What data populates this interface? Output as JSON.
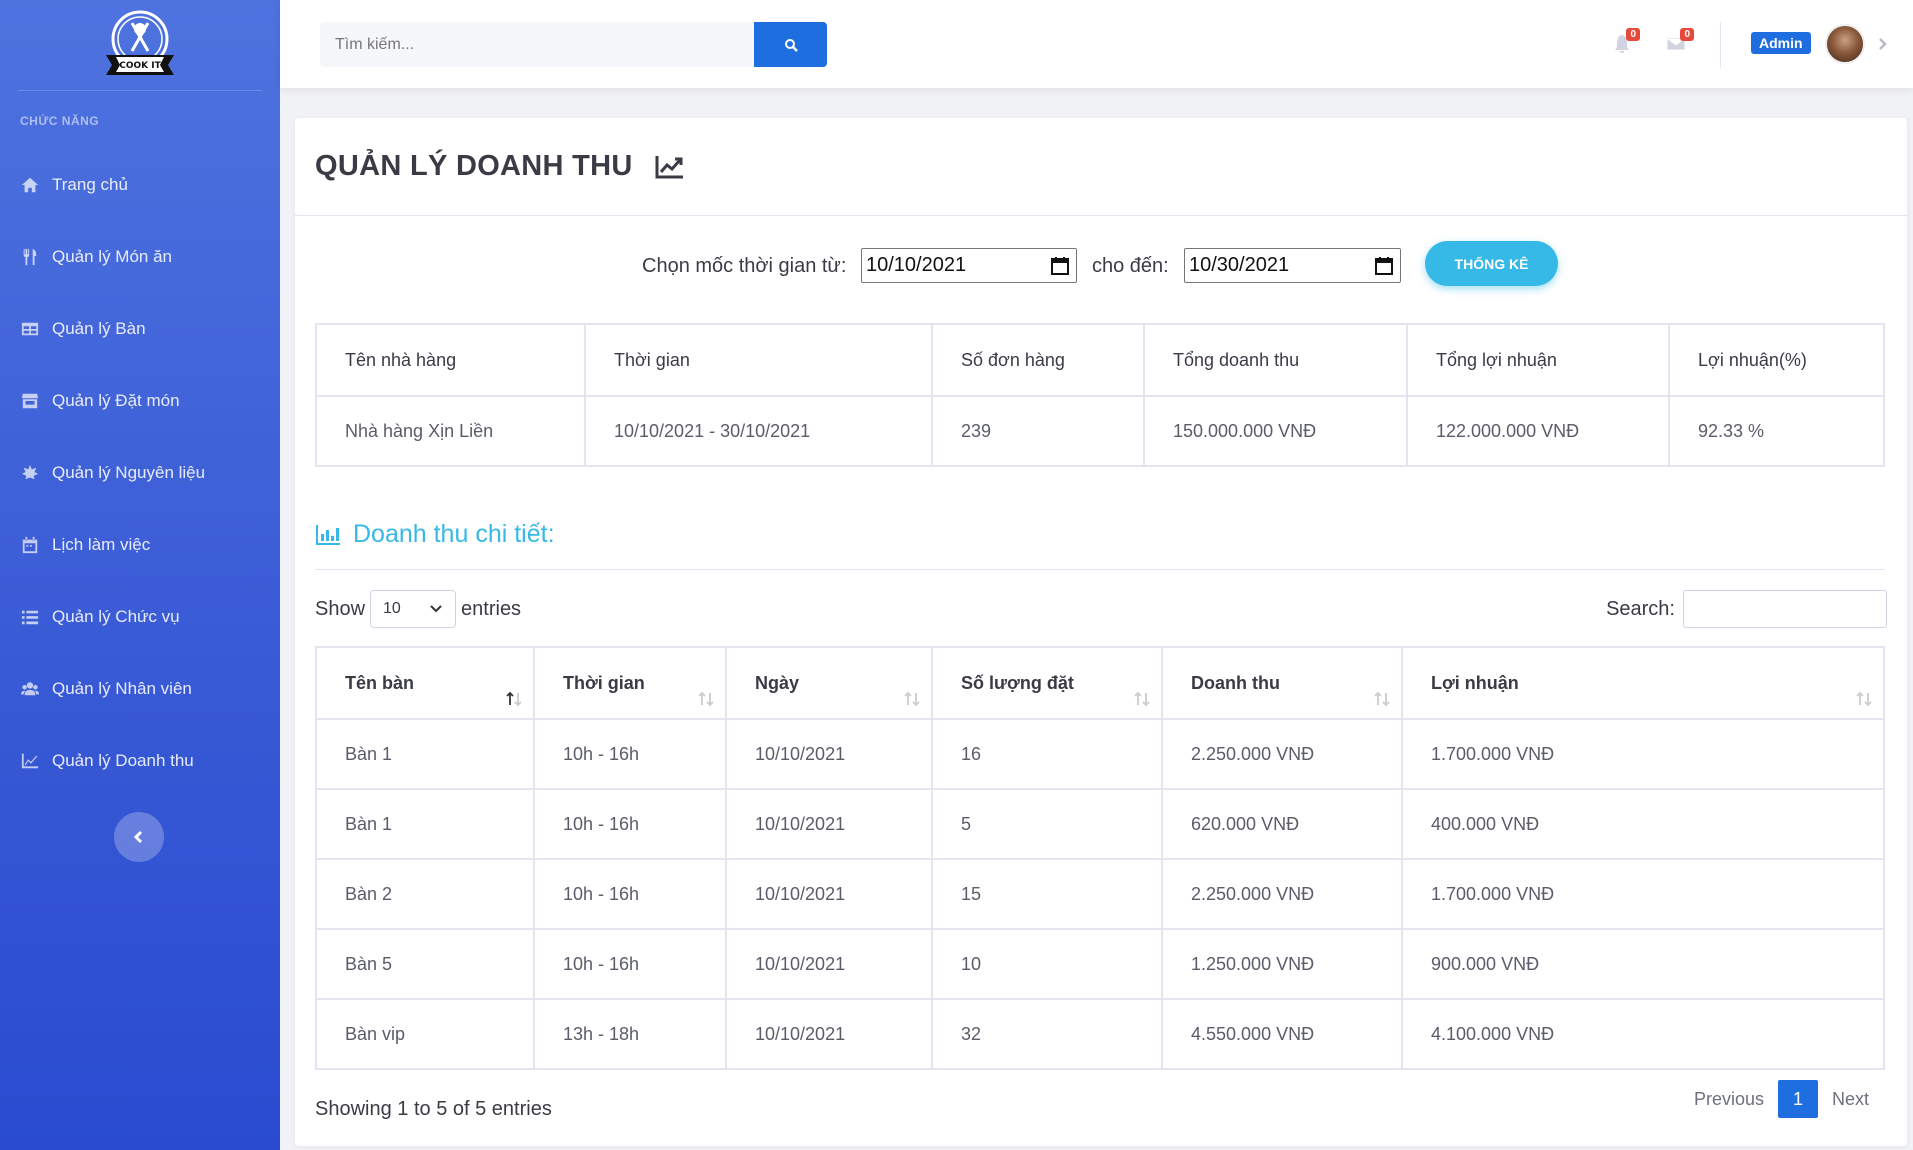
{
  "brand": {
    "logo_text": "COOK IT"
  },
  "sidebar": {
    "heading": "CHỨC NĂNG",
    "items": [
      {
        "label": "Trang chủ",
        "icon": "home-icon"
      },
      {
        "label": "Quản lý Món ăn",
        "icon": "utensils-icon"
      },
      {
        "label": "Quản lý Bàn",
        "icon": "table-icon"
      },
      {
        "label": "Quản lý Đặt món",
        "icon": "store-icon"
      },
      {
        "label": "Quản lý Nguyên liệu",
        "icon": "leaf-icon"
      },
      {
        "label": "Lịch làm việc",
        "icon": "calendar-icon"
      },
      {
        "label": "Quản lý Chức vụ",
        "icon": "list-icon"
      },
      {
        "label": "Quản lý Nhân viên",
        "icon": "users-icon"
      },
      {
        "label": "Quản lý Doanh thu",
        "icon": "chart-area-icon"
      }
    ]
  },
  "topbar": {
    "search_placeholder": "Tìm kiếm...",
    "alerts_count": "0",
    "messages_count": "0",
    "user_name": "Admin"
  },
  "page": {
    "title": "QUẢN LÝ DOANH THU",
    "from_label": "Chọn mốc thời gian từ:",
    "from_date": "10/10/2021",
    "to_label": "cho đến:",
    "to_date": "10/30/2021",
    "stat_button": "THỐNG KÊ"
  },
  "summary": {
    "headers": [
      "Tên nhà hàng",
      "Thời gian",
      "Số đơn hàng",
      "Tổng doanh thu",
      "Tổng lợi nhuận",
      "Lợi nhuận(%)"
    ],
    "row": [
      "Nhà hàng Xịn Liền",
      "10/10/2021 - 30/10/2021",
      "239",
      "150.000.000 VNĐ",
      "122.000.000 VNĐ",
      "92.33 %"
    ]
  },
  "detail": {
    "title": "Doanh thu chi tiết:",
    "show_label": "Show",
    "entries_value": "10",
    "entries_label": "entries",
    "search_label": "Search:",
    "headers": [
      "Tên bàn",
      "Thời gian",
      "Ngày",
      "Số lượng đặt",
      "Doanh thu",
      "Lợi nhuận"
    ],
    "rows": [
      [
        "Bàn 1",
        "10h - 16h",
        "10/10/2021",
        "16",
        "2.250.000 VNĐ",
        "1.700.000 VNĐ"
      ],
      [
        "Bàn 1",
        "10h - 16h",
        "10/10/2021",
        "5",
        "620.000 VNĐ",
        "400.000 VNĐ"
      ],
      [
        "Bàn 2",
        "10h - 16h",
        "10/10/2021",
        "15",
        "2.250.000 VNĐ",
        "1.700.000 VNĐ"
      ],
      [
        "Bàn 5",
        "10h - 16h",
        "10/10/2021",
        "10",
        "1.250.000 VNĐ",
        "900.000 VNĐ"
      ],
      [
        "Bàn vip",
        "13h - 18h",
        "10/10/2021",
        "32",
        "4.550.000 VNĐ",
        "4.100.000 VNĐ"
      ]
    ],
    "info": "Showing 1 to 5 of 5 entries",
    "prev_label": "Previous",
    "current_page": "1",
    "next_label": "Next"
  },
  "colors": {
    "sidebar": "#4e73df",
    "primary": "#1f6ee0",
    "info": "#36b9e6",
    "danger": "#e74a3b"
  }
}
